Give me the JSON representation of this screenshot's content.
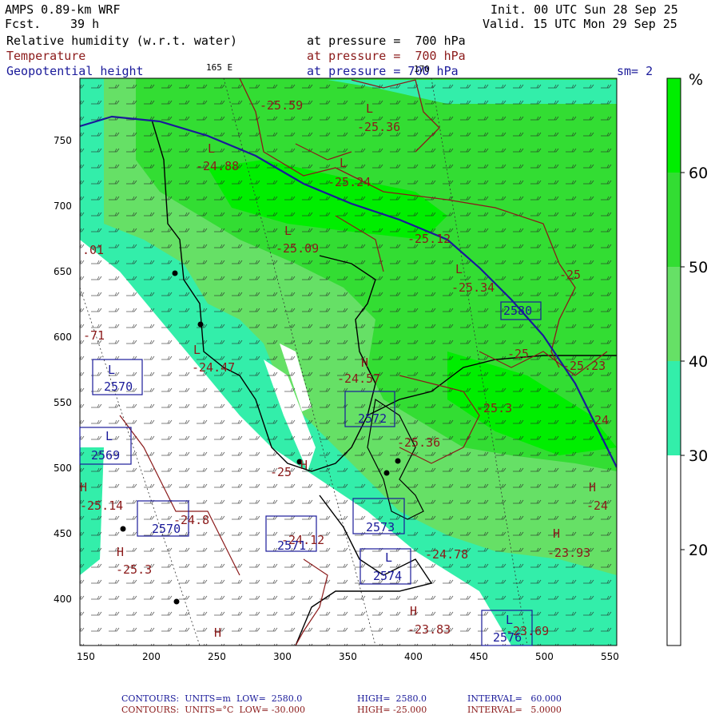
{
  "header": {
    "model": "AMPS 0.89-km WRF",
    "fcst_label": "Fcst.",
    "fcst_value": "39 h",
    "init": "Init. 00 UTC Sun 28 Sep 25",
    "valid": "Valid. 15 UTC Mon 29 Sep 25",
    "fields": [
      {
        "name": "Relative humidity (w.r.t. water)",
        "level": "at pressure =  700 hPa",
        "color": "#000000"
      },
      {
        "name": "Temperature",
        "level": "at pressure =  700 hPa",
        "color": "#8b1a1a"
      },
      {
        "name": "Geopotential height",
        "level": "at pressure = 700 hPa",
        "color": "#1a1a9a"
      }
    ],
    "smoothing": "sm= 2",
    "lon_labels": [
      "165 E",
      "170"
    ]
  },
  "axes": {
    "x_ticks": [
      "150",
      "200",
      "250",
      "300",
      "350",
      "400",
      "450",
      "500",
      "550"
    ],
    "y_ticks": [
      "750",
      "700",
      "650",
      "600",
      "550",
      "500",
      "450",
      "400"
    ]
  },
  "colorbar": {
    "unit": "%",
    "ticks": [
      "60",
      "50",
      "40",
      "30",
      "20"
    ],
    "colors": {
      "gt60": "#00ee00",
      "50_60": "#33dd33",
      "40_50": "#66e066",
      "30_40": "#33eeaa",
      "lt30": "#ffffff"
    }
  },
  "labels": {
    "temps": [
      "-25.59",
      "-25.36",
      "-24.88",
      "-25.24",
      "-25.09",
      "-25.12",
      "-25.34",
      "-25",
      "-25",
      "-25.23",
      "-24.57",
      "-25.3",
      "-25.36",
      "-24",
      "-24",
      "-24.8",
      "-25.14",
      "-25.3",
      "-24.12",
      "-24.78",
      "-23.93",
      "-23.83",
      "-23.69",
      "-24.47",
      ".01",
      "-71",
      "-25"
    ],
    "heights": [
      "2580",
      "2570",
      "2572",
      "2573",
      "2574",
      "2571",
      "2576",
      "2570",
      "2569"
    ],
    "lows": [
      "L",
      "L",
      "L",
      "L",
      "L",
      "L",
      "L",
      "L",
      "L",
      "L"
    ],
    "highs": [
      "H",
      "H",
      "H",
      "H",
      "H",
      "H",
      "H",
      "H"
    ]
  },
  "footer": {
    "line1": {
      "label": "CONTOURS:  UNITS=m  LOW=  2580.0",
      "high": "HIGH=  2580.0",
      "interval": "INTERVAL=   60.000"
    },
    "line2": {
      "label": "CONTOURS:  UNITS=°C  LOW= -30.000",
      "high": "HIGH= -25.000",
      "interval": "INTERVAL=   5.0000"
    }
  }
}
